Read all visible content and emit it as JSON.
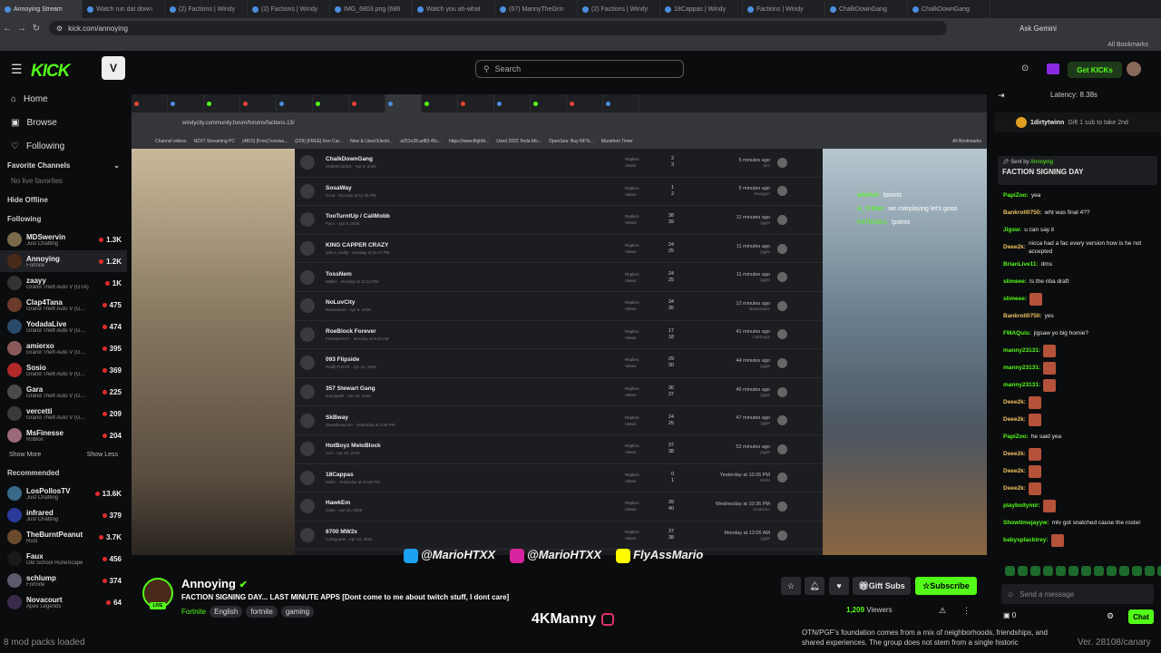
{
  "browser": {
    "tabs": [
      "Annoying Stream",
      "Watch run dat down",
      "(2) Factions | Windy",
      "(2) Factions | Windy",
      "IMG_6803.png (686",
      "Watch you ah-what",
      "(67) MannyTheGrin",
      "(2) Factions | Windy",
      "18Cappas | Windy",
      "Factions | Windy",
      "ChalkDownGang",
      "ChalkDownGang"
    ],
    "url": "kick.com/annoying",
    "ask_gemini": "Ask Gemini",
    "all_bookmarks": "All Bookmarks"
  },
  "header": {
    "logo": "KICK",
    "search_placeholder": "Search",
    "get_kicks": "Get KICKs"
  },
  "sidebar": {
    "nav": [
      {
        "label": "Home",
        "icon": "home-icon"
      },
      {
        "label": "Browse",
        "icon": "browse-icon"
      },
      {
        "label": "Following",
        "icon": "heart-icon"
      }
    ],
    "favorite_title": "Favorite Channels",
    "no_live": "No live favorites",
    "hide_offline": "Hide Offline",
    "following_title": "Following",
    "following": [
      {
        "name": "MDSwervin",
        "cat": "Just Chatting",
        "viewers": "1.3K",
        "color": "#7a6a4a"
      },
      {
        "name": "Annoying",
        "cat": "Fortnite",
        "viewers": "1.2K",
        "color": "#4a2a18"
      },
      {
        "name": "zaayy",
        "cat": "Grand Theft Auto V (GTA)",
        "viewers": "1K",
        "color": "#333"
      },
      {
        "name": "Clap4Tana",
        "cat": "Grand Theft Auto V (G...",
        "viewers": "475",
        "color": "#6a3a2a"
      },
      {
        "name": "YodadaLive",
        "cat": "Grand Theft Auto V (G...",
        "viewers": "474",
        "color": "#2a4a6a"
      },
      {
        "name": "amierxo",
        "cat": "Grand Theft Auto V (G...",
        "viewers": "395",
        "color": "#8a5a5a"
      },
      {
        "name": "Sosio",
        "cat": "Grand Theft Auto V (G...",
        "viewers": "369",
        "color": "#b02a2a"
      },
      {
        "name": "Gara",
        "cat": "Grand Theft Auto V (G...",
        "viewers": "225",
        "color": "#4a4a4a"
      },
      {
        "name": "vercetti",
        "cat": "Grand Theft Auto V (G...",
        "viewers": "209",
        "color": "#3a3a3a"
      },
      {
        "name": "MsFinesse",
        "cat": "Roblox",
        "viewers": "204",
        "color": "#9a6a7a"
      }
    ],
    "show_more": "Show More",
    "show_less": "Show Less",
    "recommended_title": "Recommended",
    "recommended": [
      {
        "name": "LosPollosTV",
        "cat": "Just Chatting",
        "viewers": "13.6K",
        "color": "#3a6a8a"
      },
      {
        "name": "infrared",
        "cat": "Just Chatting",
        "viewers": "379",
        "color": "#2a3a9a"
      },
      {
        "name": "TheBurntPeanut",
        "cat": "Rust",
        "viewers": "3.7K",
        "color": "#6a4a2a"
      },
      {
        "name": "Faux",
        "cat": "Old School RuneScape",
        "viewers": "456",
        "color": "#1a1a1a"
      },
      {
        "name": "schlump",
        "cat": "Fortnite",
        "viewers": "374",
        "color": "#5a5a6a"
      },
      {
        "name": "Novacourt",
        "cat": "Apex Legends",
        "viewers": "64",
        "color": "#3a2a4a"
      }
    ]
  },
  "stream": {
    "inner_url": "windycity.community.forum/forums/factions.13/",
    "inner_bookmarks": [
      "Channel videos",
      "NZXT Streaming PC",
      "(4815) [Free] Iceowa...",
      "(229) [FREE] Ken Car...",
      "New & Used Electri...",
      "a251e28.ad83.45c...",
      "https://www.flighth...",
      "Used 2022 Tesla Mo...",
      "OpenSea: Buy NFTs...",
      "Marathon Timer"
    ],
    "inner_all_bookmarks": "All Bookmarks",
    "forum_rows": [
      {
        "name": "ChalkDownGang",
        "sub": "ONEOF1DOG · Apr 9, 2026",
        "replies": "2",
        "views": "3",
        "last": "5 minutes ago",
        "user": "slim"
      },
      {
        "name": "SosaWay",
        "sub": "Scott · Monday at 11:45 PM",
        "replies": "1",
        "views": "2",
        "last": "5 minutes ago",
        "user": "Swagger"
      },
      {
        "name": "TooTurntUp / CaliMobb",
        "sub": "Paco · Apr 9, 2026",
        "replies": "38",
        "views": "39",
        "last": "11 minutes ago",
        "user": "jiggle"
      },
      {
        "name": "KING CAPPER CRAZY",
        "sub": "yaboi_reality · Monday at 11:47 PM",
        "replies": "24",
        "views": "25",
        "last": "11 minutes ago",
        "user": "jiggle"
      },
      {
        "name": "TossNem",
        "sub": "Mellitz · Monday at 11:13 PM",
        "replies": "24",
        "views": "25",
        "last": "11 minutes ago",
        "user": "jiggle"
      },
      {
        "name": "NoLuvCity",
        "sub": "Baseenbee · Apr 9, 2026",
        "replies": "34",
        "views": "35",
        "last": "12 minutes ago",
        "user": "Baseenbee"
      },
      {
        "name": "RoeBlock Forever",
        "sub": "Freedamm17 · Monday at 8:23 AM",
        "replies": "17",
        "views": "18",
        "last": "41 minutes ago",
        "user": "CalShops"
      },
      {
        "name": "093 Flipside",
        "sub": "ReallyTrench · Apr 10, 2026",
        "replies": "29",
        "views": "30",
        "last": "44 minutes ago",
        "user": "jiggle"
      },
      {
        "name": "357 Stewart Gang",
        "sub": "kutcapakit · Apr 10, 2026",
        "replies": "36",
        "views": "37",
        "last": "46 minutes ago",
        "user": "jiggle"
      },
      {
        "name": "SkBway",
        "sub": "drewskisayone · Yesterday at 3:56 PM",
        "replies": "24",
        "views": "25",
        "last": "47 minutes ago",
        "user": "jiggle"
      },
      {
        "name": "HotBoyz MeloBlock",
        "sub": "excl · Apr 10, 2026",
        "replies": "37",
        "views": "38",
        "last": "52 minutes ago",
        "user": "jiggle"
      },
      {
        "name": "18Cappas",
        "sub": "Mollo · Yesterday at 10:26 PM",
        "replies": "0",
        "views": "1",
        "last": "Yesterday at 10:26 PM",
        "user": "Mollo"
      },
      {
        "name": "HawkEm",
        "sub": "oxaty · Apr 10, 2026",
        "replies": "39",
        "views": "40",
        "last": "Wednesday at 10:36 PM",
        "user": "bostoneo"
      },
      {
        "name": "6700 MW2x",
        "sub": "CalSquads · Apr 10, 2026",
        "replies": "37",
        "views": "38",
        "last": "Monday at 12:05 AM",
        "user": "jiggle"
      }
    ],
    "replies_label": "Replies:",
    "views_label": "Views:",
    "overlay_chat": [
      {
        "user": "adotfuh:",
        "text": "!points"
      },
      {
        "user": "A_TcMan:",
        "text": "we roleplaying let's gooo"
      },
      {
        "user": "FATRISK1:",
        "text": "!points"
      }
    ],
    "socials": [
      "@MarioHTXX",
      "@MarioHTXX",
      "FlyAssMario"
    ]
  },
  "info": {
    "streamer": "Annoying",
    "live": "LIVE",
    "title": "FACTION SIGNING DAY... LAST MINUTE APPS  [Dont come to me about twitch stuff, I dont care]",
    "category": "Fortnite",
    "tags": [
      "English",
      "fortnite",
      "gaming"
    ],
    "gift_subs": "Gift Subs",
    "subscribe": "Subscribe",
    "viewers": "1,209",
    "viewers_label": "Viewers"
  },
  "overlay": {
    "watermark": "4KManny",
    "obs_status": "8 mod packs loaded",
    "obs_text": "OTN/PGF's foundation comes from a mix of neighborhoods, friendships, and shared experiences. The group does not stem from a single historic",
    "version": "Ver. 28108/canary"
  },
  "chat": {
    "latency": "Latency: 8.38s",
    "gift_user": "1dirtytwinn",
    "gift_count": "2",
    "gift_text": "Gift 1 sub to take 2nd",
    "pinned_by": "Sent by",
    "pinned_user": "Annoying",
    "pinned_text": "FACTION SIGNING DAY",
    "messages": [
      {
        "user": "PapiZoo:",
        "text": "yea",
        "color": "#53fc18",
        "emote": false
      },
      {
        "user": "Bankroll0750:",
        "text": "wht was final 4??",
        "color": "#f0c060",
        "emote": false
      },
      {
        "user": "Jigsw:",
        "text": "u can say it",
        "color": "#53fc18",
        "emote": false
      },
      {
        "user": "Deee2k:",
        "text": "nicca had a fac every version how is he not accepted",
        "color": "#f0c060",
        "emote": false
      },
      {
        "user": "BrianLive11:",
        "text": "dms",
        "color": "#53fc18",
        "emote": false
      },
      {
        "user": "slimeee:",
        "text": "ts the nba draft",
        "color": "#53fc18",
        "emote": false
      },
      {
        "user": "slimeee:",
        "text": "",
        "color": "#53fc18",
        "emote": true
      },
      {
        "user": "Bankroll0750:",
        "text": "yes",
        "color": "#f0c060",
        "emote": false
      },
      {
        "user": "FMAQuis:",
        "text": "jigsaw yo big homie?",
        "color": "#53fc18",
        "emote": false
      },
      {
        "user": "manny23131:",
        "text": "",
        "color": "#53fc18",
        "emote": true
      },
      {
        "user": "manny23131:",
        "text": "",
        "color": "#53fc18",
        "emote": true
      },
      {
        "user": "manny23131:",
        "text": "",
        "color": "#53fc18",
        "emote": true
      },
      {
        "user": "Deee2k:",
        "text": "",
        "color": "#f0c060",
        "emote": true
      },
      {
        "user": "Deee2k:",
        "text": "",
        "color": "#f0c060",
        "emote": true
      },
      {
        "user": "PapiZoo:",
        "text": "he said yea",
        "color": "#53fc18",
        "emote": false
      },
      {
        "user": "Deee2k:",
        "text": "",
        "color": "#f0c060",
        "emote": true
      },
      {
        "user": "Deee2k:",
        "text": "",
        "color": "#f0c060",
        "emote": true
      },
      {
        "user": "Deee2k:",
        "text": "",
        "color": "#f0c060",
        "emote": true
      },
      {
        "user": "playboitymir:",
        "text": "",
        "color": "#53fc18",
        "emote": true
      },
      {
        "user": "Showtimejayyw:",
        "text": "mtv got snatched cause the roster",
        "color": "#53fc18",
        "emote": false
      },
      {
        "user": "babysplacktrey:",
        "text": "",
        "color": "#53fc18",
        "emote": true
      }
    ],
    "input_placeholder": "Send a message",
    "kicks": "0",
    "send": "Chat"
  }
}
